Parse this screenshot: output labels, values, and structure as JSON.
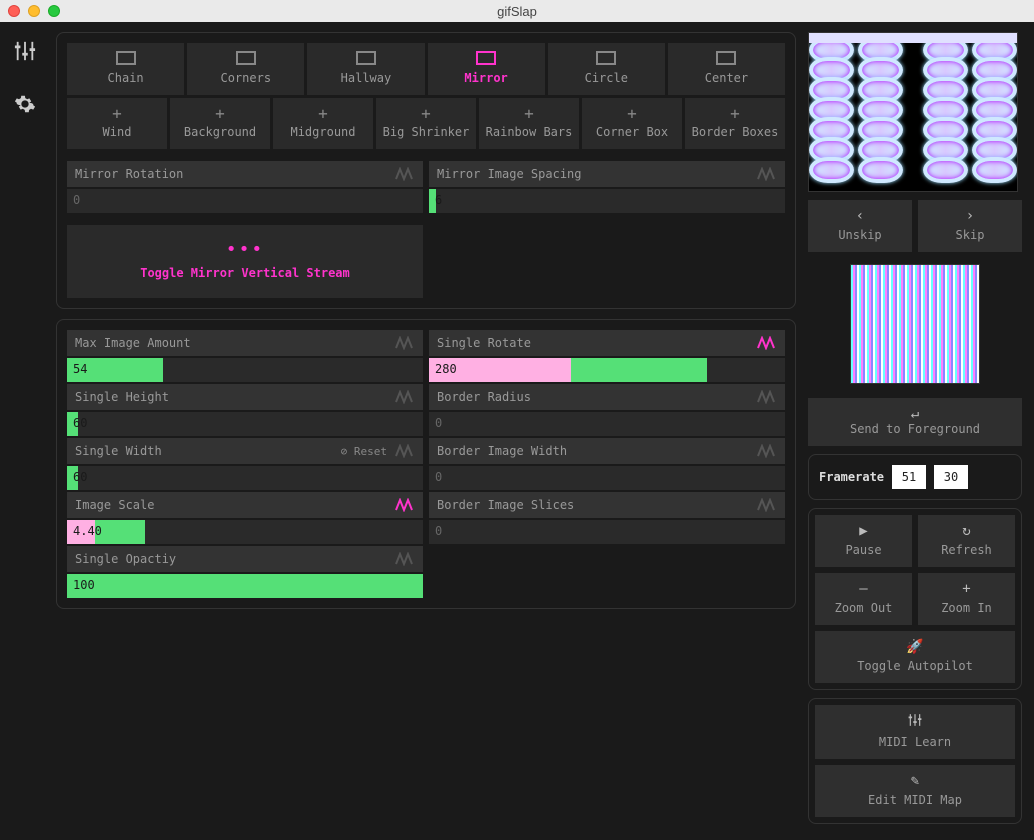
{
  "window": {
    "title": "gifSlap"
  },
  "tabs": [
    {
      "label": "Chain"
    },
    {
      "label": "Corners"
    },
    {
      "label": "Hallway"
    },
    {
      "label": "Mirror",
      "active": true
    },
    {
      "label": "Circle"
    },
    {
      "label": "Center"
    }
  ],
  "addons": [
    {
      "label": "Wind"
    },
    {
      "label": "Background"
    },
    {
      "label": "Midground"
    },
    {
      "label": "Big Shrinker"
    },
    {
      "label": "Rainbow Bars"
    },
    {
      "label": "Corner Box"
    },
    {
      "label": "Border Boxes"
    }
  ],
  "mirror": {
    "rotation": {
      "label": "Mirror Rotation",
      "value": "0",
      "fill_pct": 0
    },
    "spacing": {
      "label": "Mirror Image Spacing",
      "value": "6",
      "fill_pct": 2
    },
    "toggle": "Toggle Mirror Vertical Stream"
  },
  "sliders_left": [
    {
      "label": "Max Image Amount",
      "value": "54",
      "fill_pct": 27,
      "wave_active": false
    },
    {
      "label": "Single Height",
      "value": "60",
      "fill_pct": 3,
      "wave_active": false
    },
    {
      "label": "Single Width",
      "value": "60",
      "fill_pct": 3,
      "wave_active": false,
      "reset": "Reset"
    },
    {
      "label": "Image Scale",
      "value": "4.40",
      "fill_pct": 22,
      "fill2_pct": 8,
      "wave_active": true
    },
    {
      "label": "Single Opactiy",
      "value": "100",
      "fill_pct": 100,
      "wave_active": false
    }
  ],
  "sliders_right": [
    {
      "label": "Single Rotate",
      "value": "280",
      "fill_pct": 78,
      "fill2_pct": 40,
      "wave_active": true
    },
    {
      "label": "Border Radius",
      "value": "0",
      "fill_pct": 0,
      "wave_active": false
    },
    {
      "label": "Border Image Width",
      "value": "0",
      "fill_pct": 0,
      "wave_active": false
    },
    {
      "label": "Border Image Slices",
      "value": "0",
      "fill_pct": 0,
      "wave_active": false
    }
  ],
  "right": {
    "unskip": "Unskip",
    "skip": "Skip",
    "send_fg": "Send to Foreground",
    "framerate_label": "Framerate",
    "framerate_a": "51",
    "framerate_b": "30",
    "pause": "Pause",
    "refresh": "Refresh",
    "zoom_out": "Zoom Out",
    "zoom_in": "Zoom In",
    "autopilot": "Toggle Autopilot",
    "midi_learn": "MIDI Learn",
    "midi_map": "Edit MIDI Map"
  }
}
